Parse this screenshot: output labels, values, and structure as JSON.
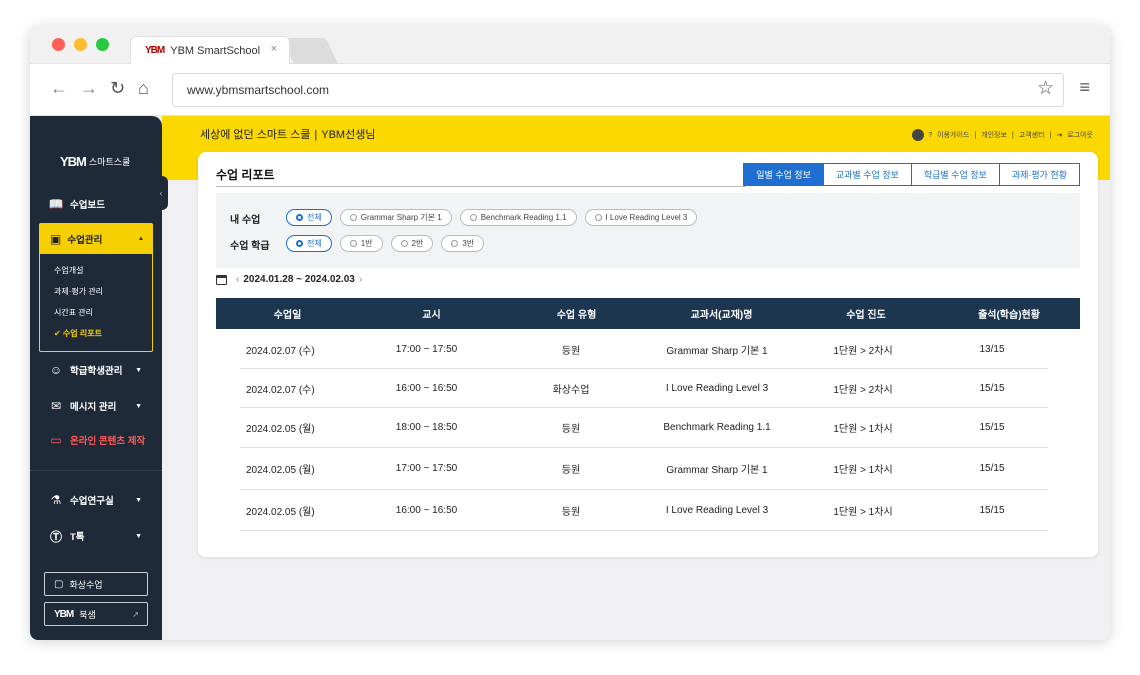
{
  "browser": {
    "tab_title": "YBM SmartSchool",
    "tab_logo": "YBM",
    "url": "www.ybmsmartschool.com",
    "colors": {
      "close": "#ff5f57",
      "minimize": "#febc2e",
      "zoom": "#28c840"
    }
  },
  "sidebar": {
    "brand_logo": "YBM",
    "brand_name": "스마트스쿨",
    "items": [
      {
        "label": "수업보드",
        "icon": "book-icon"
      },
      {
        "label": "수업관리",
        "icon": "presentation-icon",
        "expanded": true
      },
      {
        "label": "학급학생관리",
        "icon": "group-icon"
      },
      {
        "label": "메시지 관리",
        "icon": "message-icon"
      },
      {
        "label": "온라인 콘텐츠 제작",
        "icon": "monitor-icon"
      },
      {
        "label": "수업연구실",
        "icon": "microscope-icon"
      },
      {
        "label": "T톡",
        "icon": "t-talk-icon"
      }
    ],
    "sub_items": [
      {
        "label": "수업개설"
      },
      {
        "label": "과제·평가 관리"
      },
      {
        "label": "시간표 관리"
      },
      {
        "label": "✔ 수업 리포트",
        "active": true
      }
    ],
    "buttons": [
      {
        "label": "화상수업",
        "icon": "video-class-icon"
      },
      {
        "label": "북샘",
        "logo": "YBM",
        "icon": "external-link-icon"
      }
    ],
    "accent_color": "#f5cf00"
  },
  "header": {
    "slogan": "세상에 없던 스마트 스쿨",
    "teacher": "YBM선생님",
    "links": [
      "이용가이드",
      "개인정보",
      "고객센터",
      "로그아웃"
    ]
  },
  "report": {
    "title": "수업 리포트",
    "tabs": [
      "일별 수업 정보",
      "교과별 수업 정보",
      "학급별 수업 정보",
      "과제·평가 현황"
    ],
    "active_tab": 0,
    "filters": {
      "my_class_label": "내 수업",
      "my_class_options": [
        "전체",
        "Grammar Sharp 기본 1",
        "Benchmark Reading 1.1",
        "I Love Reading Level 3"
      ],
      "grade_label": "수업 학급",
      "grade_options": [
        "전체",
        "1반",
        "2반",
        "3반"
      ]
    },
    "date_range": "2024.01.28 ~ 2024.02.03",
    "columns": [
      "수업일",
      "교시",
      "수업 유형",
      "교과서(교재)명",
      "수업 진도",
      "출석(학습)현황"
    ],
    "rows": [
      {
        "date": "2024.02.07 (수)",
        "period": "17:00 ~ 17:50",
        "type": "등원",
        "textbook": "Grammar Sharp 기본 1",
        "progress": "1단원 > 2차시",
        "attendance": "13/15"
      },
      {
        "date": "2024.02.07 (수)",
        "period": "16:00 ~ 16:50",
        "type": "화상수업",
        "textbook": "I Love Reading Level 3",
        "progress": "1단원 > 2차시",
        "attendance": "15/15"
      },
      {
        "date": "2024.02.05 (월)",
        "period": "18:00 ~ 18:50",
        "type": "등원",
        "textbook": "Benchmark Reading 1.1",
        "progress": "1단원 > 1차시",
        "attendance": "15/15"
      },
      {
        "date": "2024.02.05 (월)",
        "period": "17:00 ~ 17:50",
        "type": "등원",
        "textbook": "Grammar Sharp 기본 1",
        "progress": "1단원 > 1차시",
        "attendance": "15/15"
      },
      {
        "date": "2024.02.05 (월)",
        "period": "16:00 ~ 16:50",
        "type": "등원",
        "textbook": "I Love Reading Level 3",
        "progress": "1단원 > 1차시",
        "attendance": "15/15"
      }
    ],
    "colors": {
      "primary": "#1e6fd0",
      "table_header": "#1c3650",
      "banner": "#fad800"
    }
  }
}
